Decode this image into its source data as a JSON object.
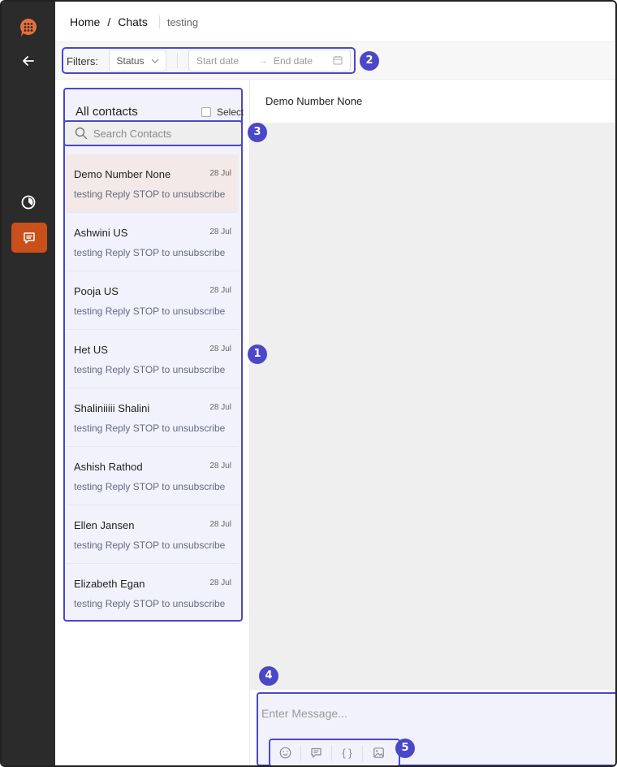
{
  "breadcrumb": {
    "home": "Home",
    "separator": "/",
    "current": "Chats",
    "campaign": "testing"
  },
  "filters": {
    "label": "Filters:",
    "status": "Status",
    "start_date": "Start date",
    "end_date": "End date",
    "arrow": "→"
  },
  "contacts": {
    "title": "All contacts",
    "select_label": "Select",
    "search_placeholder": "Search Contacts",
    "items": [
      {
        "name": "Demo Number None",
        "date": "28 Jul",
        "preview": "testing Reply STOP to unsubscribe"
      },
      {
        "name": "Ashwini US",
        "date": "28 Jul",
        "preview": "testing Reply STOP to unsubscribe"
      },
      {
        "name": "Pooja US",
        "date": "28 Jul",
        "preview": "testing Reply STOP to unsubscribe"
      },
      {
        "name": "Het US",
        "date": "28 Jul",
        "preview": "testing Reply STOP to unsubscribe"
      },
      {
        "name": "Shaliniiiii Shalini",
        "date": "28 Jul",
        "preview": "testing Reply STOP to unsubscribe"
      },
      {
        "name": "Ashish Rathod",
        "date": "28 Jul",
        "preview": "testing Reply STOP to unsubscribe"
      },
      {
        "name": "Ellen Jansen",
        "date": "28 Jul",
        "preview": "testing Reply STOP to unsubscribe"
      },
      {
        "name": "Elizabeth Egan",
        "date": "28 Jul",
        "preview": "testing Reply STOP to unsubscribe"
      }
    ]
  },
  "chat": {
    "title": "Demo Number None",
    "message_placeholder": "Enter Message...",
    "variable_tool": "{ }"
  },
  "annotations": [
    "1",
    "2",
    "3",
    "4",
    "5"
  ],
  "colors": {
    "accent": "#4b47c9",
    "brand": "#c9501a",
    "rail": "#2b2b2b"
  },
  "icons": [
    "brand-logo-icon",
    "back-arrow-icon",
    "clock-icon",
    "chat-icon",
    "chevron-down-icon",
    "calendar-icon",
    "search-icon",
    "emoji-icon",
    "template-icon",
    "image-icon"
  ]
}
